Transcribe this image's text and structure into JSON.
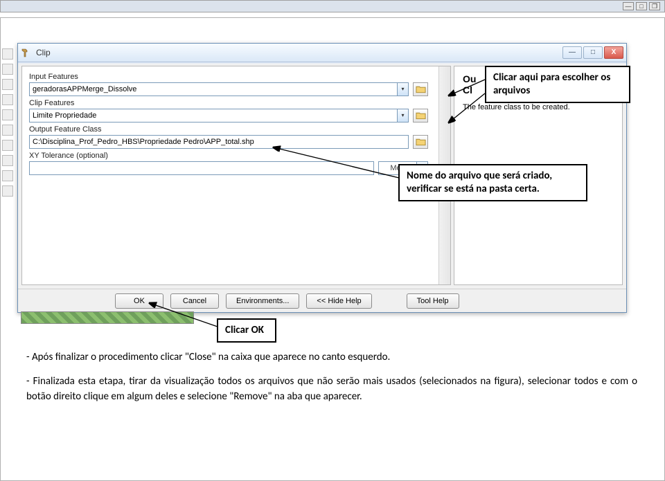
{
  "outer_window": {
    "min": "—",
    "max": "□",
    "restore": "❐"
  },
  "dialog": {
    "title": "Clip",
    "win_min": "—",
    "win_max": "□",
    "win_close": "X",
    "labels": {
      "input_features": "Input Features",
      "clip_features": "Clip Features",
      "output_feature_class": "Output Feature Class",
      "xy_tolerance": "XY Tolerance (optional)"
    },
    "values": {
      "input_features": "geradorasAPPMerge_Dissolve",
      "clip_features": "Limite Propriedade",
      "output_feature_class": "C:\\Disciplina_Prof_Pedro_HBS\\Propriedade Pedro\\APP_total.shp",
      "xy_tolerance": "",
      "xy_unit": "Meters"
    },
    "help": {
      "heading_prefix": "Ou",
      "heading_line2": "Cl",
      "body": "The feature class to be created."
    },
    "buttons": {
      "ok": "OK",
      "cancel": "Cancel",
      "environments": "Environments...",
      "hide_help": "<< Hide Help",
      "tool_help": "Tool Help"
    }
  },
  "callouts": {
    "c1": "Clicar aqui para escolher os arquivos",
    "c2": "Nome do arquivo que será criado, verificar se está na pasta certa.",
    "c3": "Clicar OK"
  },
  "instructions": {
    "p1": "- Após finalizar o procedimento clicar \"Close\" na caixa que aparece no canto esquerdo.",
    "p2": "- Finalizada esta etapa, tirar da visualização todos os arquivos que não serão mais usados (selecionados na figura), selecionar todos e com o botão direito clique em algum deles e selecione \"Remove\" na aba que aparecer."
  }
}
